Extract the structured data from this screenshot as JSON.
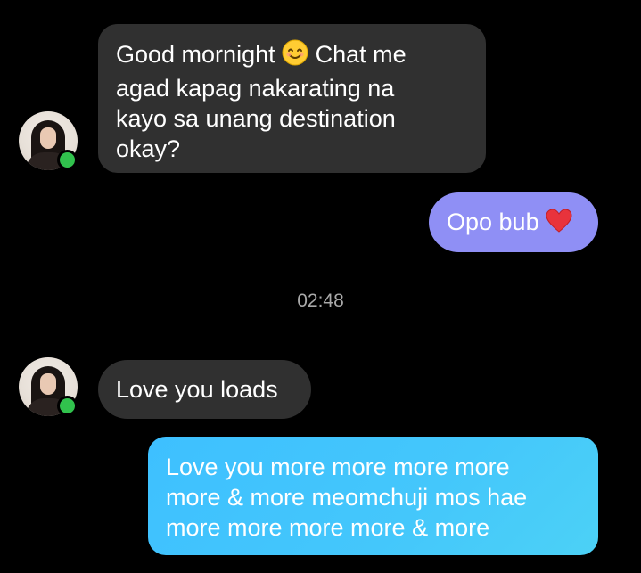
{
  "conversation": {
    "messages": [
      {
        "direction": "incoming",
        "text_before_emoji": "Good mornight ",
        "emoji": "smiling-face-with-smiling-eyes",
        "text_after_emoji": " Chat me\nagad kapag nakarating na\nkayo sa unang destination\nokay?"
      },
      {
        "direction": "outgoing",
        "text": "Opo bub ",
        "emoji": "red-heart"
      },
      {
        "direction": "incoming",
        "text": "Love you loads"
      },
      {
        "direction": "outgoing",
        "text": "Love you more more more more\nmore & more meomchuji mos hae\nmore more more more & more"
      }
    ],
    "timestamp": "02:48",
    "contact": {
      "status": "online"
    }
  },
  "colors": {
    "background": "#000000",
    "incoming_bubble": "#303030",
    "outgoing_bubble_purple": "#8f8ff5",
    "outgoing_bubble_blue": "#44c7fb",
    "online_indicator": "#31c24d",
    "timestamp_text": "#a9a9a9"
  }
}
